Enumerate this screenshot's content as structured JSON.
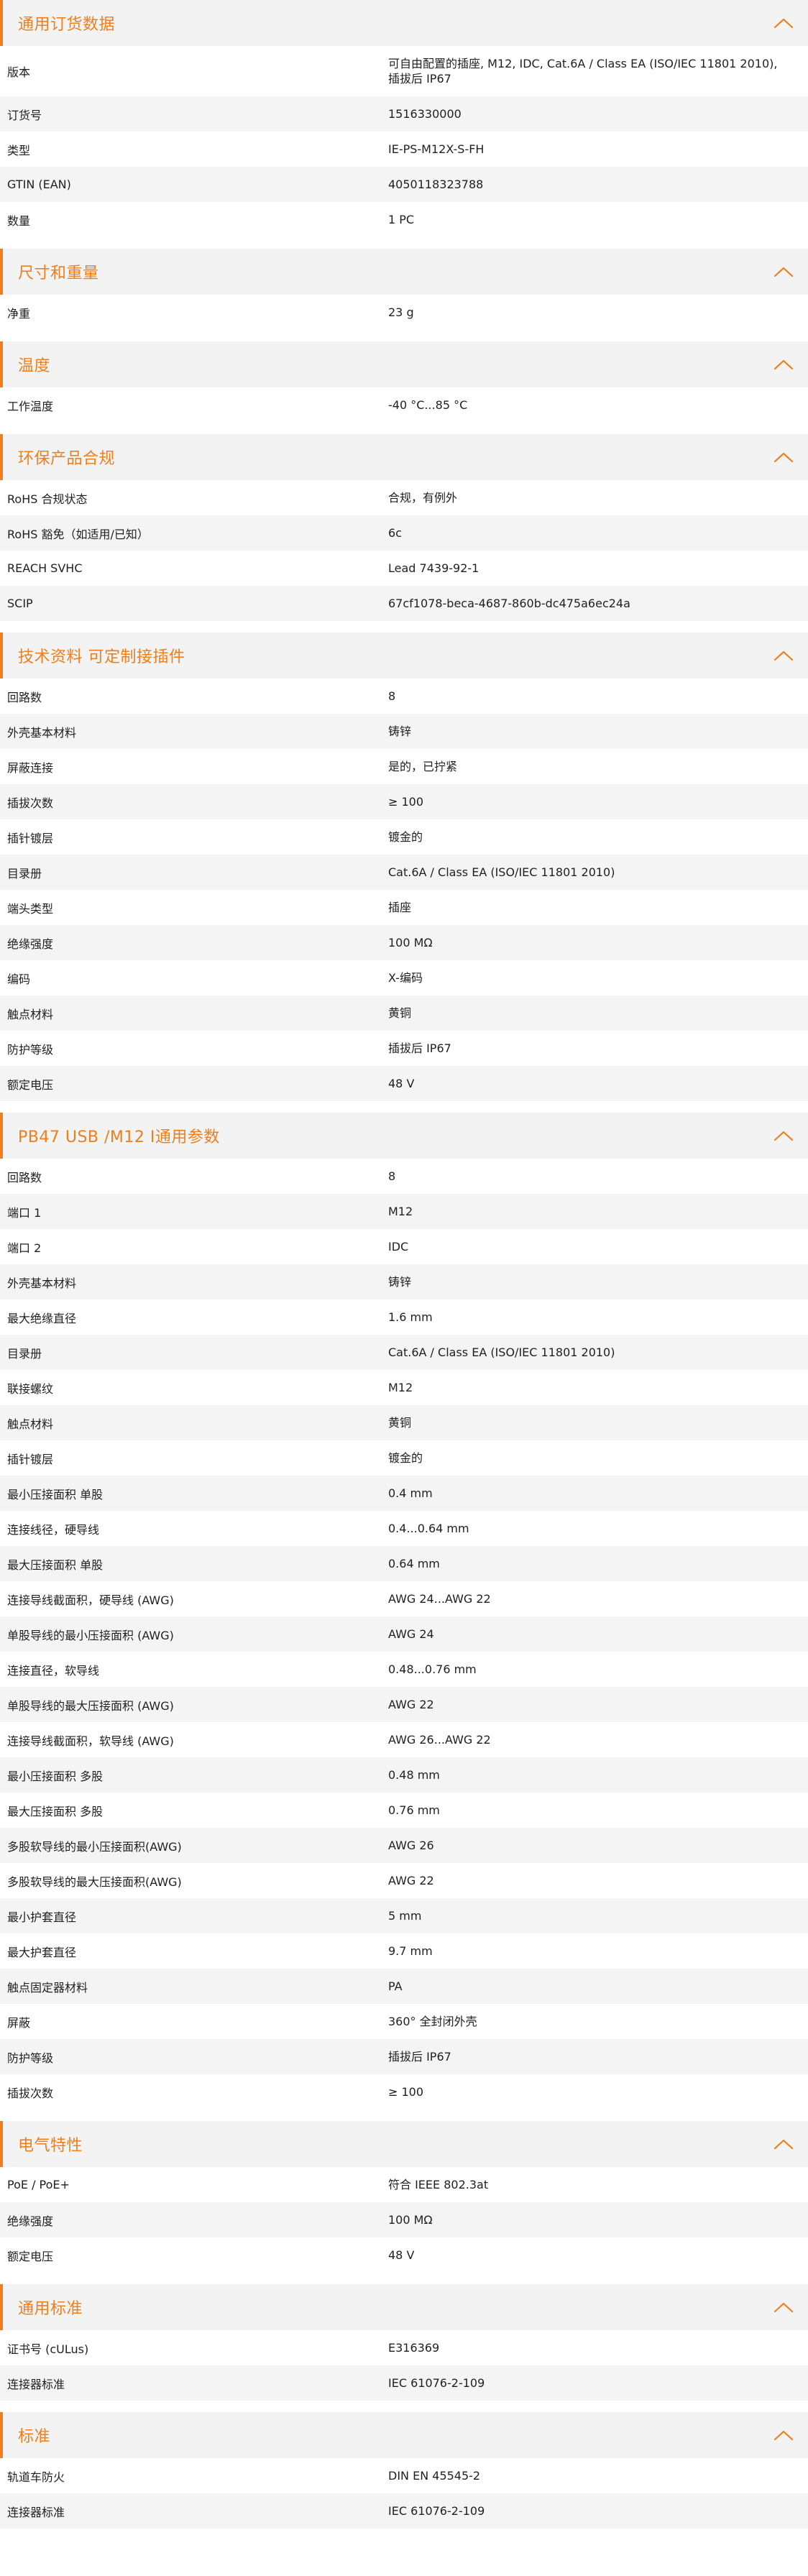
{
  "colors": {
    "accent": "#f07e1b",
    "stripe": "#f4f4f4",
    "header_bg": "#f3f3f3"
  },
  "icons": {
    "section_toggle": "chevron-up-icon"
  },
  "sections": [
    {
      "title": "通用订货数据",
      "rows": [
        {
          "label": "版本",
          "value": "可自由配置的插座, M12, IDC, Cat.6A / Class EA (ISO/IEC 11801 2010), 插拔后 IP67"
        },
        {
          "label": "订货号",
          "value": "1516330000"
        },
        {
          "label": "类型",
          "value": "IE-PS-M12X-S-FH"
        },
        {
          "label": "GTIN (EAN)",
          "value": "4050118323788"
        },
        {
          "label": "数量",
          "value": "1  PC"
        }
      ]
    },
    {
      "title": "尺寸和重量",
      "rows": [
        {
          "label": "净重",
          "value": "23  g"
        }
      ]
    },
    {
      "title": "温度",
      "rows": [
        {
          "label": "工作温度",
          "value": "-40 °C...85 °C"
        }
      ]
    },
    {
      "title": "环保产品合规",
      "rows": [
        {
          "label": "RoHS 合规状态",
          "value": "合规，有例外"
        },
        {
          "label": "RoHS 豁免（如适用/已知）",
          "value": "6c"
        },
        {
          "label": "REACH SVHC",
          "value": "Lead 7439-92-1"
        },
        {
          "label": "SCIP",
          "value": "67cf1078-beca-4687-860b-dc475a6ec24a"
        }
      ]
    },
    {
      "title": "技术资料 可定制接插件",
      "rows": [
        {
          "label": "回路数",
          "value": "8"
        },
        {
          "label": "外壳基本材料",
          "value": "铸锌"
        },
        {
          "label": "屏蔽连接",
          "value": "是的，已拧紧"
        },
        {
          "label": "插拔次数",
          "value": "≥ 100"
        },
        {
          "label": "插针镀层",
          "value": "镀金的"
        },
        {
          "label": "目录册",
          "value": "Cat.6A / Class EA (ISO/IEC 11801 2010)"
        },
        {
          "label": "端头类型",
          "value": "插座"
        },
        {
          "label": "绝缘强度",
          "value": "100 MΩ"
        },
        {
          "label": "编码",
          "value": "X-编码"
        },
        {
          "label": "触点材料",
          "value": "黄铜"
        },
        {
          "label": "防护等级",
          "value": "插拔后 IP67"
        },
        {
          "label": "额定电压",
          "value": "48  V"
        }
      ]
    },
    {
      "title": "PB47 USB /M12 I通用参数",
      "rows": [
        {
          "label": "回路数",
          "value": "8"
        },
        {
          "label": "端口 1",
          "value": "M12"
        },
        {
          "label": "端口 2",
          "value": "IDC"
        },
        {
          "label": "外壳基本材料",
          "value": "铸锌"
        },
        {
          "label": "最大绝缘直径",
          "value": "1.6  mm"
        },
        {
          "label": "目录册",
          "value": "Cat.6A / Class EA (ISO/IEC 11801 2010)"
        },
        {
          "label": "联接螺纹",
          "value": "M12"
        },
        {
          "label": "触点材料",
          "value": "黄铜"
        },
        {
          "label": "插针镀层",
          "value": "镀金的"
        },
        {
          "label": "最小压接面积 单股",
          "value": "0.4  mm"
        },
        {
          "label": "连接线径，硬导线",
          "value": "0.4...0.64 mm"
        },
        {
          "label": "最大压接面积 单股",
          "value": "0.64  mm"
        },
        {
          "label": "连接导线截面积，硬导线 (AWG)",
          "value": "AWG 24...AWG 22"
        },
        {
          "label": "单股导线的最小压接面积 (AWG)",
          "value": "AWG 24"
        },
        {
          "label": "连接直径，软导线",
          "value": "0.48...0.76 mm"
        },
        {
          "label": "单股导线的最大压接面积 (AWG)",
          "value": "AWG 22"
        },
        {
          "label": "连接导线截面积，软导线 (AWG)",
          "value": "AWG 26...AWG 22"
        },
        {
          "label": "最小压接面积 多股",
          "value": "0.48  mm"
        },
        {
          "label": "最大压接面积 多股",
          "value": "0.76  mm"
        },
        {
          "label": "多股软导线的最小压接面积(AWG)",
          "value": "AWG 26"
        },
        {
          "label": "多股软导线的最大压接面积(AWG)",
          "value": "AWG 22"
        },
        {
          "label": "最小护套直径",
          "value": "5  mm"
        },
        {
          "label": "最大护套直径",
          "value": "9.7  mm"
        },
        {
          "label": "触点固定器材料",
          "value": "PA"
        },
        {
          "label": "屏蔽",
          "value": "360° 全封闭外壳"
        },
        {
          "label": "防护等级",
          "value": "插拔后 IP67"
        },
        {
          "label": "插拔次数",
          "value": "≥ 100"
        }
      ]
    },
    {
      "title": "电气特性",
      "rows": [
        {
          "label": "PoE / PoE+",
          "value": "符合 IEEE 802.3at"
        },
        {
          "label": "绝缘强度",
          "value": "100 MΩ"
        },
        {
          "label": "额定电压",
          "value": "48  V"
        }
      ]
    },
    {
      "title": "通用标准",
      "rows": [
        {
          "label": "证书号 (cULus)",
          "value": "E316369"
        },
        {
          "label": "连接器标准",
          "value": "IEC 61076-2-109"
        }
      ]
    },
    {
      "title": "标准",
      "rows": [
        {
          "label": "轨道车防火",
          "value": "DIN EN 45545-2"
        },
        {
          "label": "连接器标准",
          "value": "IEC 61076-2-109"
        }
      ]
    }
  ]
}
